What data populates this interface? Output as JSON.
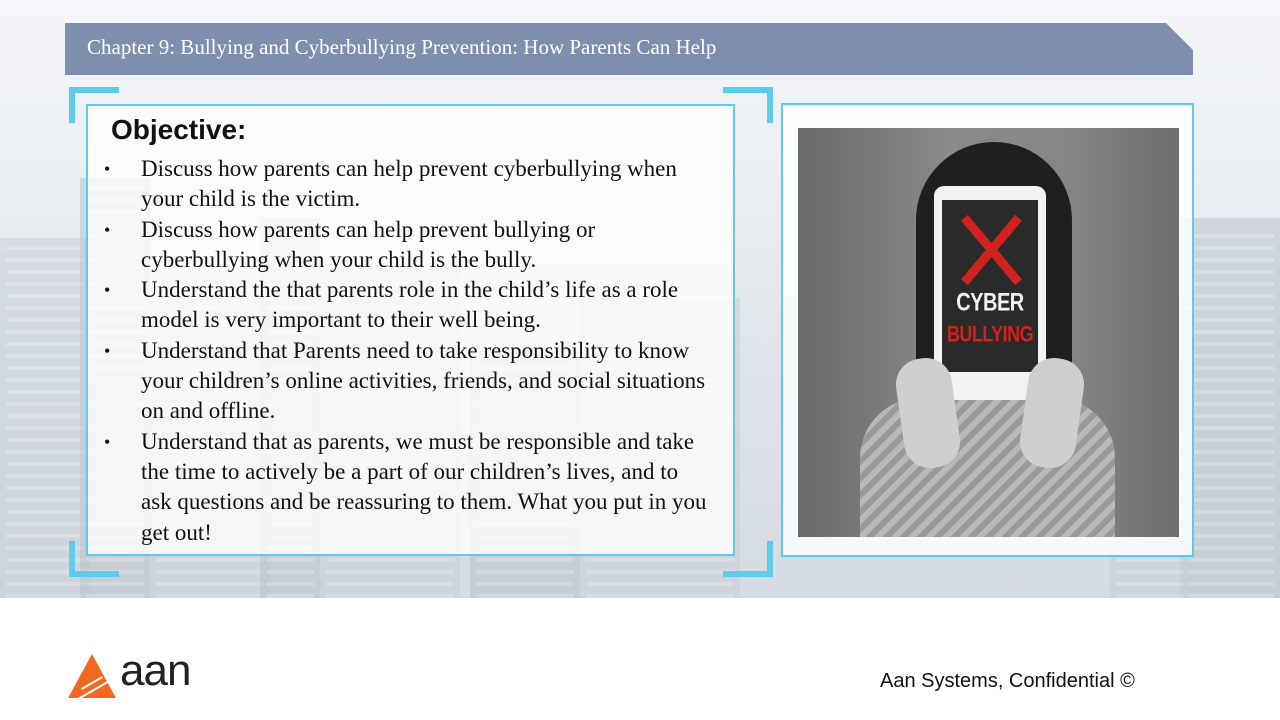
{
  "slide": {
    "title": "Chapter 9: Bullying and Cyberbullying Prevention: How Parents Can Help"
  },
  "objective": {
    "heading": "Objective:",
    "bullets": [
      "Discuss how parents can help prevent cyberbullying when your child is the victim.",
      "Discuss how parents can help prevent bullying or cyberbullying when your child is the bully.",
      "Understand the that parents role in the child’s life as a role model is very important to their well being.",
      "Understand that Parents need to take responsibility to know your children’s online activities, friends, and social situations on and offline.",
      "Understand that as parents, we must be responsible and take the time to actively be a part of our children’s lives, and to ask questions and be reassuring to them.  What you put in you get out!"
    ],
    "bullet_glyph": "•"
  },
  "image": {
    "tablet_line1": "CYBER",
    "tablet_line2": "BULLYING"
  },
  "footer": {
    "logo_text": "aan",
    "confidential": "Aan Systems, Confidential ©"
  },
  "colors": {
    "title_bar": "#7d8fad",
    "accent": "#5ecbec",
    "logo_orange": "#f26722",
    "x_red": "#d0221f"
  }
}
